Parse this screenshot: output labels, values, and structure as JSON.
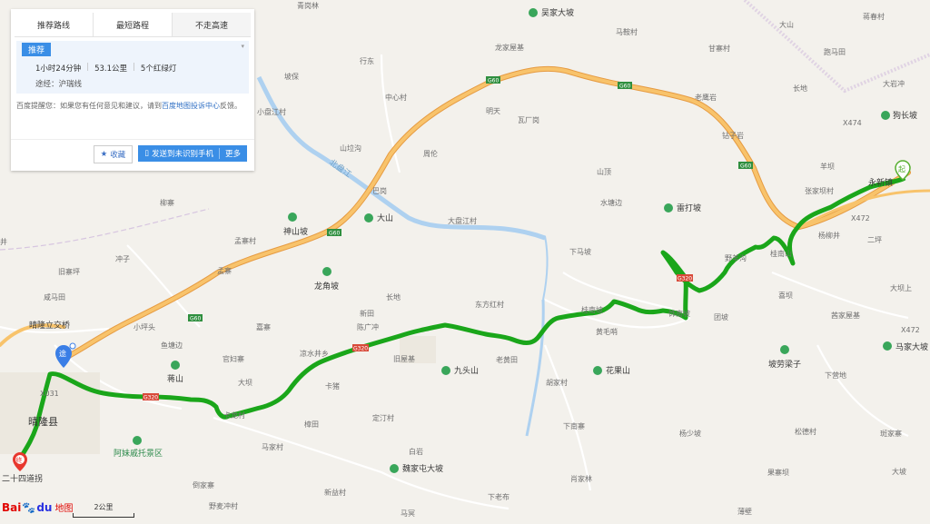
{
  "panel": {
    "tabs": [
      {
        "label": "推荐路线",
        "active": false
      },
      {
        "label": "最短路程",
        "active": false
      },
      {
        "label": "不走高速",
        "active": true
      }
    ],
    "tag": "推荐",
    "collapse_icon": "chevron-icon",
    "duration": "1小时24分钟",
    "distance": "53.1公里",
    "lights": "5个红绿灯",
    "via": "途经：沪瑞线",
    "feedback_text": "百度提醒您：如果您有任何意见和建议，请到",
    "feedback_link": "百度地图投诉中心",
    "feedback_tail": "反馈。",
    "favorite_label": "收藏",
    "send_label": "发送到未识别手机",
    "more_label": "更多"
  },
  "markers": {
    "start": "起",
    "end": "终",
    "via": "途"
  },
  "labels": {
    "start_town": "永新镇",
    "end_place": "二十四道拐",
    "county": "晴隆县",
    "interchange": "晴隆立交桥",
    "river": "北盘江",
    "river2": "大盘江村"
  },
  "places": [
    "青岗林",
    "吴家大坡",
    "马鞍村",
    "甘寨村",
    "大山",
    "蒋春村",
    "龙家屋基",
    "跑马田",
    "大岩冲",
    "坡保",
    "行东",
    "老鹰岩",
    "长地",
    "狗长坡",
    "小盘江村",
    "明天",
    "瓦厂岗",
    "钻子岩",
    "中心村",
    "山垃沟",
    "周伦",
    "山顶",
    "羊坝",
    "巴岗",
    "张家坝村",
    "水塘边",
    "雷打坡",
    "大山",
    "大盘江村",
    "下马坡",
    "杨柳井",
    "二坪",
    "神山坡",
    "柳寨",
    "孟寨村",
    "野羊沟",
    "桂南山",
    "孟寨",
    "龙角坡",
    "长地",
    "东方红村",
    "新田",
    "大坝上",
    "旧寨坪",
    "盐井",
    "陈广冲",
    "饰南坡",
    "团坡",
    "茜家屋基",
    "咸马田",
    "凉水井乡",
    "黄毛哨",
    "马家大坡",
    "九头山",
    "老黄田",
    "花果山",
    "坡劳梁子",
    "下营地",
    "晴隆县",
    "蒋山",
    "官妇寨",
    "大坝",
    "卡猪",
    "胡家村",
    "松德村",
    "二十四道拐",
    "阿妹戚托景区",
    "定汀村",
    "下南寨",
    "杨少坡",
    "斑家寨",
    "马家村",
    "白岩",
    "魏家屯大坡",
    "果寨坝",
    "大坡",
    "倒家寨",
    "新益村",
    "肖家林",
    "野麦冲村",
    "下老布",
    "马冥",
    "薄壁"
  ],
  "road_shields": [
    "G60",
    "G60",
    "G60",
    "G60",
    "G320",
    "G320",
    "G320",
    "X474",
    "X472",
    "X472",
    "X031"
  ],
  "scale": "2公里",
  "logo": {
    "bai": "Bai",
    "du": "du",
    "map": "地图"
  },
  "colors": {
    "route": "#22b024",
    "expressway": "#f6b45a",
    "river": "#a9cdef",
    "start_marker": "#56ae2e",
    "end_marker": "#e8372e",
    "via_marker": "#3a7ee6",
    "tag_bg": "#3a8ee6"
  }
}
